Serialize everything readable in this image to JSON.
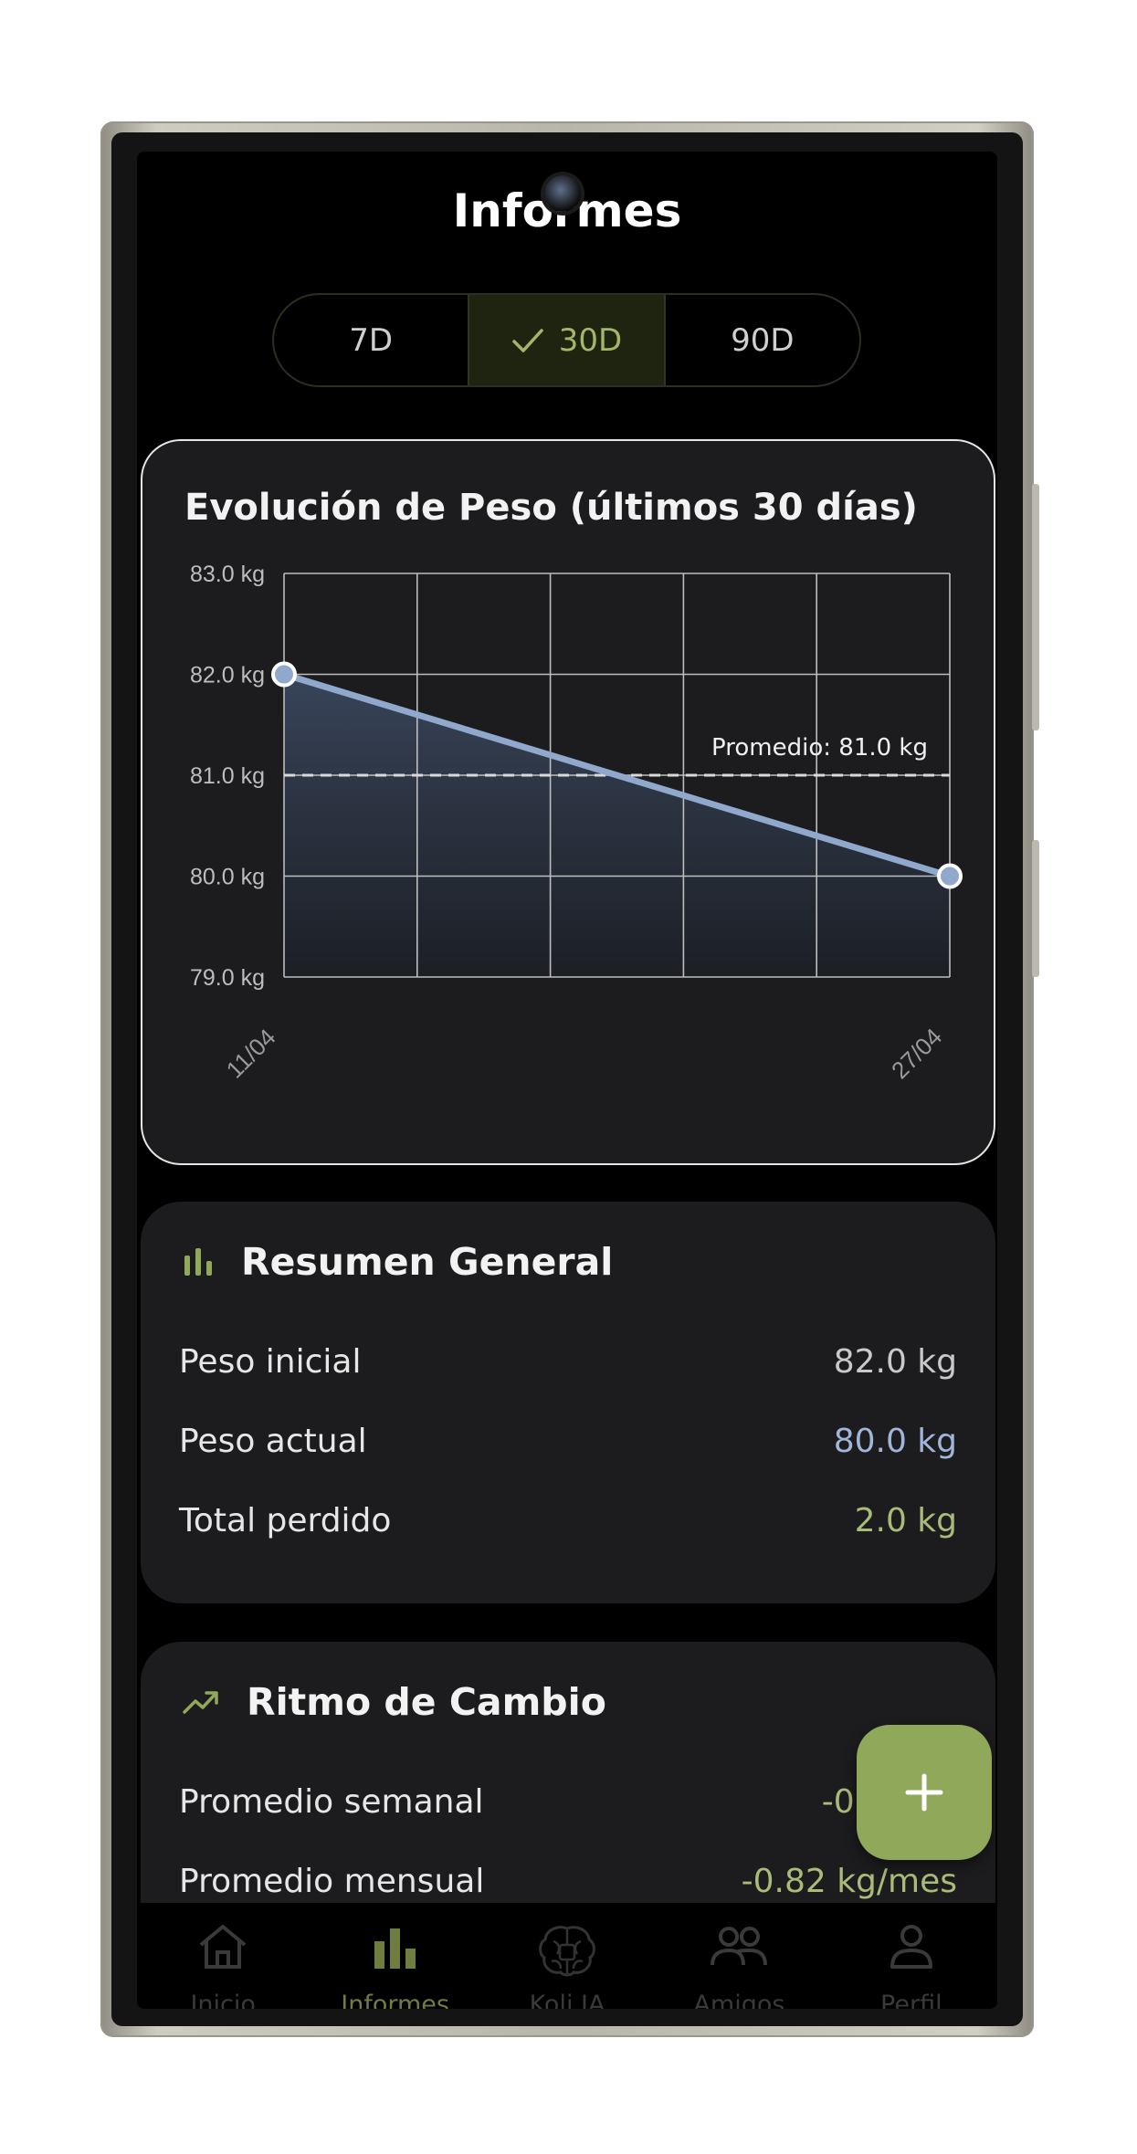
{
  "header": {
    "title": "Informes"
  },
  "period_selector": {
    "options": [
      "7D",
      "30D",
      "90D"
    ],
    "selected": "30D"
  },
  "weight_chart": {
    "title": "Evolución de Peso (últimos 30 días)",
    "average_label": "Promedio: 81.0 kg"
  },
  "chart_data": {
    "type": "area",
    "title": "Evolución de Peso (últimos 30 días)",
    "x": [
      "11/04",
      "27/04"
    ],
    "series": [
      {
        "values": [
          82.0,
          80.0
        ]
      }
    ],
    "ylim": [
      79.0,
      83.0
    ],
    "y_ticks": [
      "83.0 kg",
      "82.0 kg",
      "81.0 kg",
      "80.0 kg",
      "79.0 kg"
    ],
    "y_tick_values": [
      83.0,
      82.0,
      81.0,
      80.0,
      79.0
    ],
    "reference_line": {
      "value": 81.0,
      "label": "Promedio: 81.0 kg",
      "style": "dashed"
    },
    "grid": true,
    "line_color": "#8fa8cb"
  },
  "summary": {
    "title": "Resumen General",
    "rows": [
      {
        "label": "Peso inicial",
        "value": "82.0 kg"
      },
      {
        "label": "Peso actual",
        "value": "80.0 kg"
      },
      {
        "label": "Total perdido",
        "value": "2.0 kg"
      }
    ]
  },
  "rate": {
    "title": "Ritmo de Cambio",
    "rows": [
      {
        "label": "Promedio semanal",
        "value": "-0.19 kg"
      },
      {
        "label": "Promedio mensual",
        "value": "-0.82 kg/mes"
      }
    ]
  },
  "fab": {
    "icon": "plus-icon"
  },
  "bottom_nav": [
    {
      "label": "Inicio",
      "icon": "home-icon"
    },
    {
      "label": "Informes",
      "icon": "bar-chart-icon"
    },
    {
      "label": "Koli IA",
      "icon": "brain-icon"
    },
    {
      "label": "Amigos",
      "icon": "friends-icon"
    },
    {
      "label": "Perfil",
      "icon": "profile-icon"
    }
  ],
  "colors": {
    "accent": "#8fa85a",
    "blue_value": "#9fb6d9",
    "green_value": "#a9bb78",
    "card": "#1c1c1e",
    "background": "#000000"
  }
}
